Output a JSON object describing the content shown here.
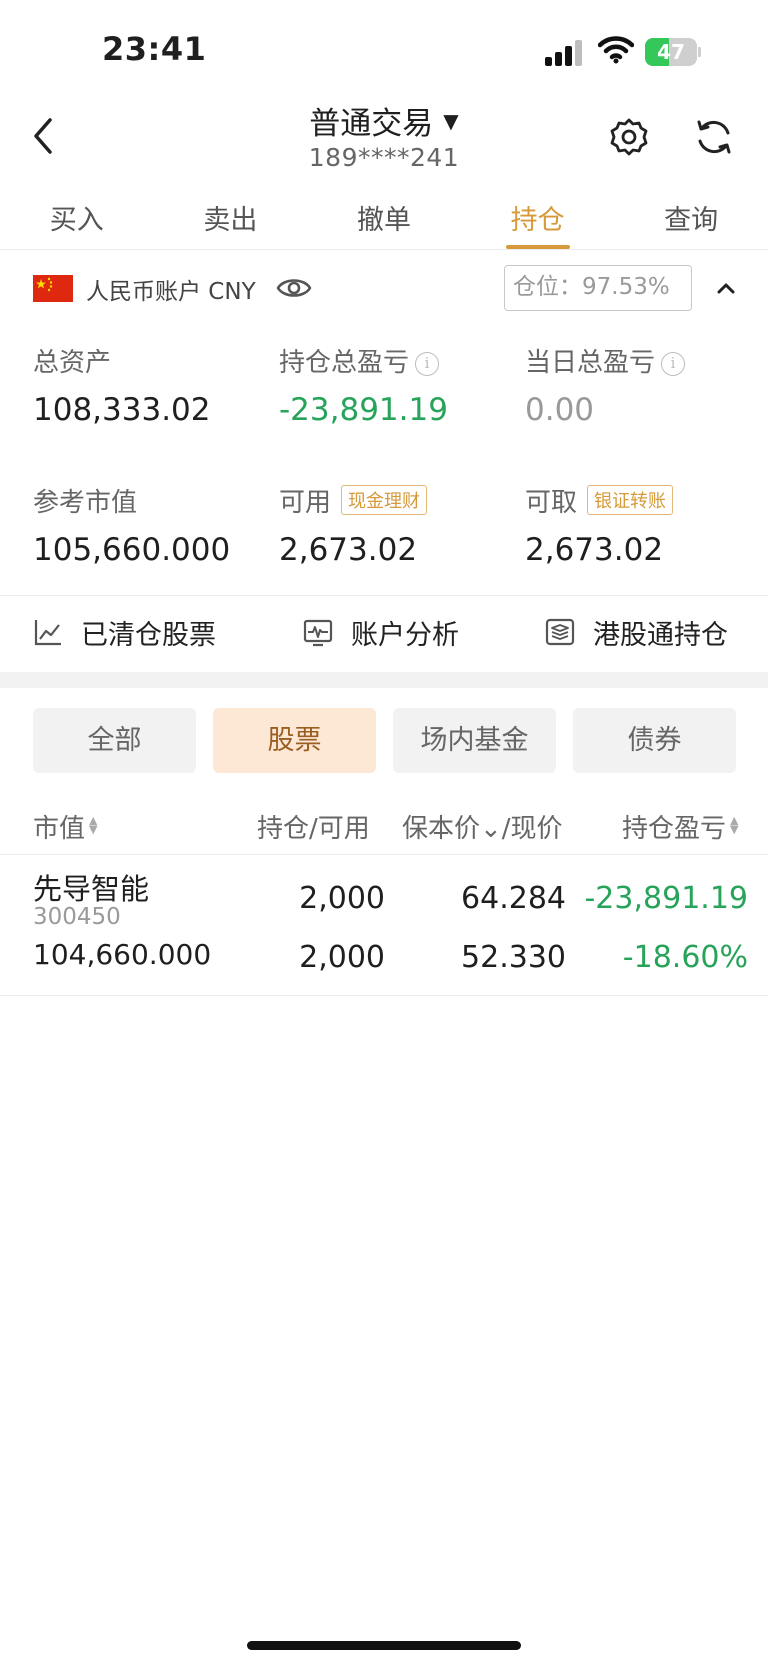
{
  "status_bar": {
    "time": "23:41",
    "battery": "47",
    "battery_level": 0.47
  },
  "header": {
    "title": "普通交易",
    "title_caret": "▼",
    "account": "189****241"
  },
  "tabs": [
    {
      "label": "买入",
      "active": false
    },
    {
      "label": "卖出",
      "active": false
    },
    {
      "label": "撤单",
      "active": false
    },
    {
      "label": "持仓",
      "active": true
    },
    {
      "label": "查询",
      "active": false
    }
  ],
  "account": {
    "name": "人民币账户 CNY",
    "position_label": "仓位：",
    "position_value": "97.53%"
  },
  "metrics": {
    "total_assets": {
      "label": "总资产",
      "value": "108,333.02"
    },
    "holding_pnl": {
      "label": "持仓总盈亏",
      "value": "-23,891.19"
    },
    "daily_pnl": {
      "label": "当日总盈亏",
      "value": "0.00"
    },
    "market_value": {
      "label": "参考市值",
      "value": "105,660.000"
    },
    "available": {
      "label": "可用",
      "tag": "现金理财",
      "value": "2,673.02"
    },
    "withdrawable": {
      "label": "可取",
      "tag": "银证转账",
      "value": "2,673.02"
    }
  },
  "quick_links": [
    {
      "label": "已清仓股票",
      "icon": "chart-line-icon"
    },
    {
      "label": "账户分析",
      "icon": "pulse-monitor-icon"
    },
    {
      "label": "港股通持仓",
      "icon": "layers-icon"
    }
  ],
  "filters": [
    {
      "label": "全部",
      "active": false
    },
    {
      "label": "股票",
      "active": true
    },
    {
      "label": "场内基金",
      "active": false
    },
    {
      "label": "债券",
      "active": false
    }
  ],
  "table": {
    "headers": {
      "market_value": "市值",
      "qty": "持仓/可用",
      "price": "保本价",
      "price_sep": "⌄/现价",
      "pnl": "持仓盈亏"
    },
    "rows": [
      {
        "name": "先导智能",
        "code": "300450",
        "market_value": "104,660.000",
        "holding": "2,000",
        "available": "2,000",
        "cost_price": "64.284",
        "current_price": "52.330",
        "pnl": "-23,891.19",
        "pnl_pct": "-18.60%"
      }
    ]
  },
  "colors": {
    "accent": "#d69a3a",
    "loss_green": "#27a35a",
    "chip_active_bg": "#fde8d6"
  }
}
